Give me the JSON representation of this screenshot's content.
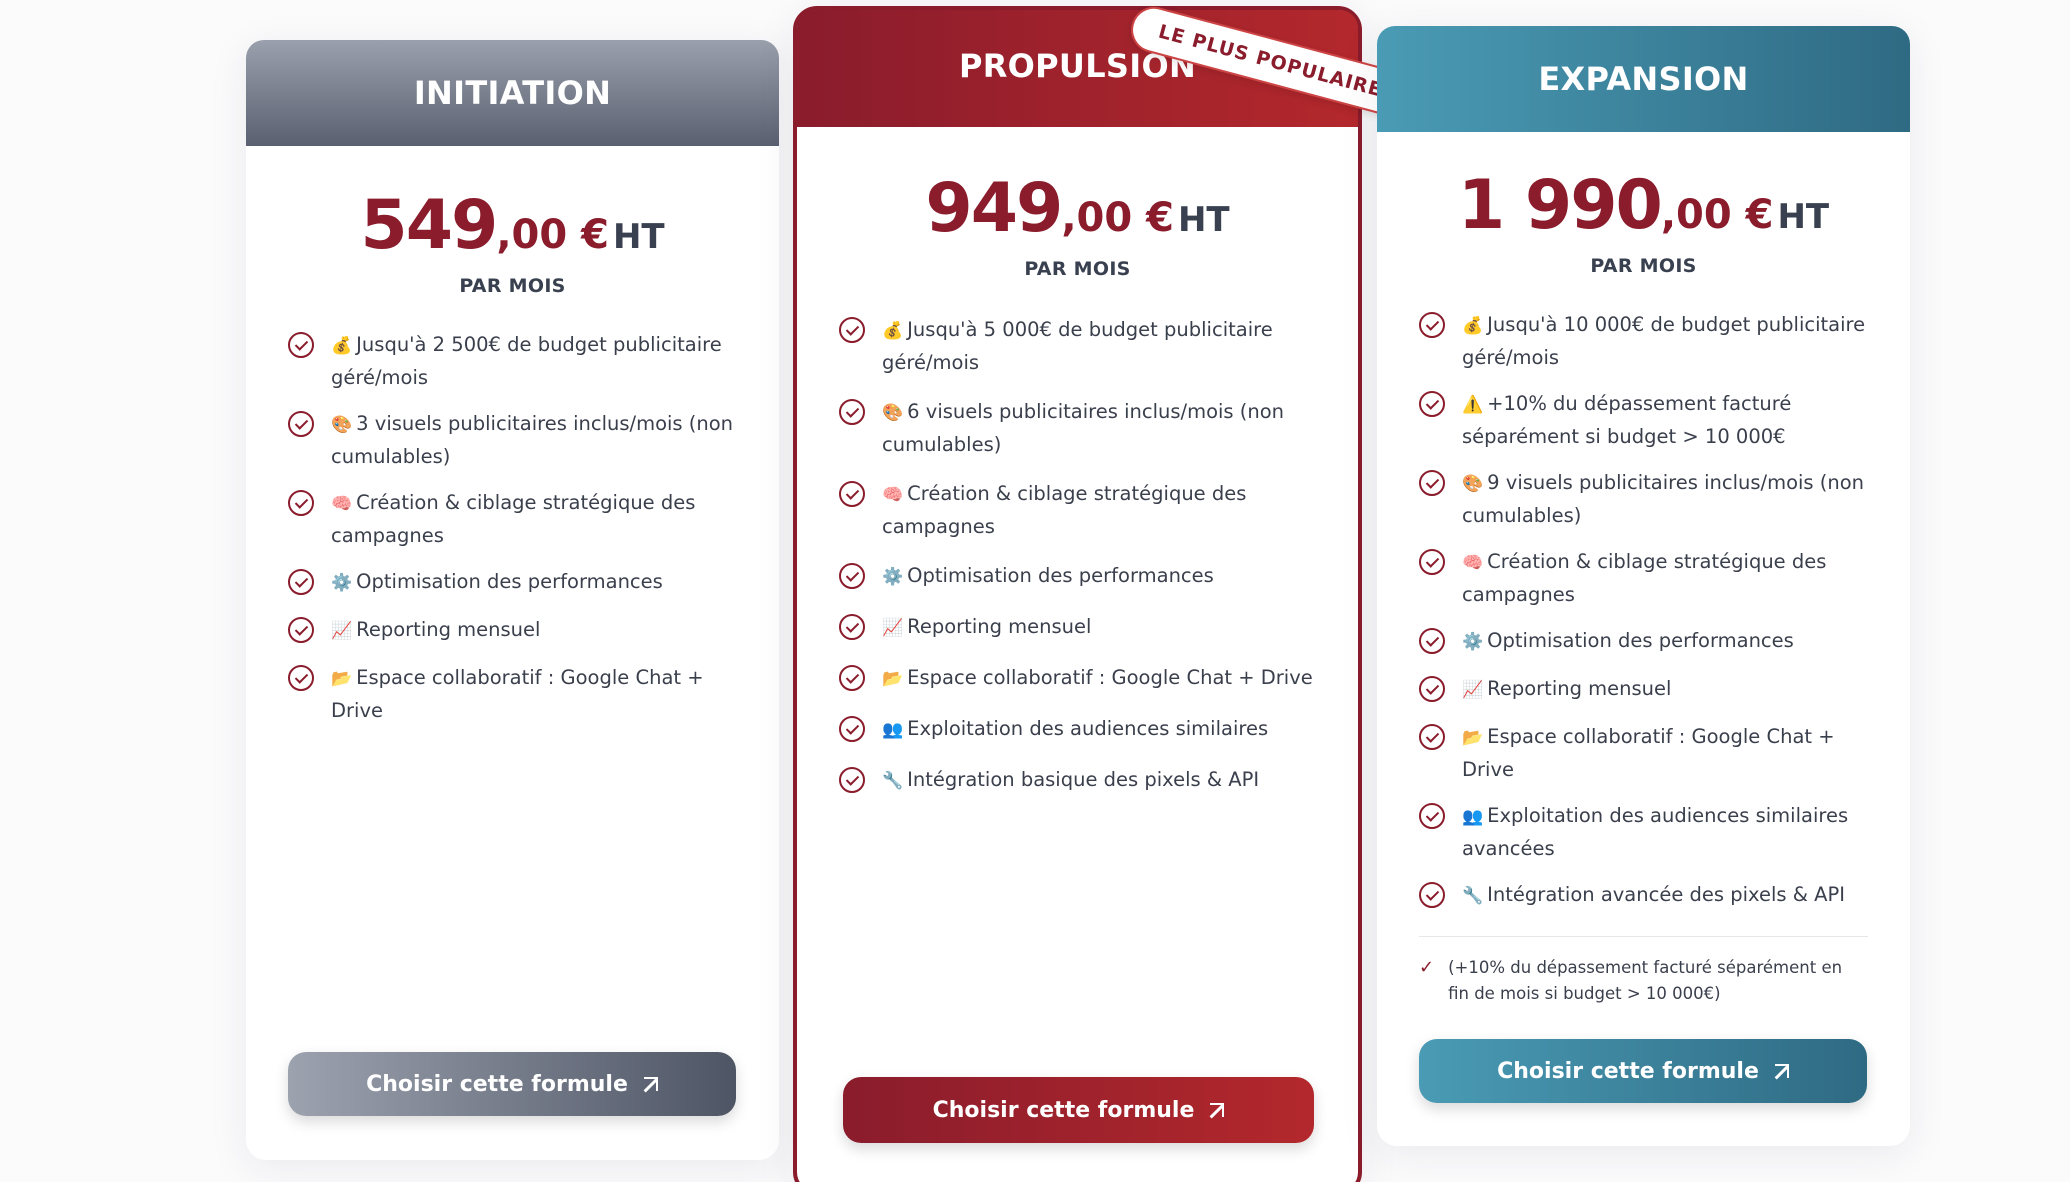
{
  "plans": [
    {
      "title": "INITIATION",
      "price_main": "549",
      "price_cents": ",00 €",
      "price_suffix": "HT",
      "period": "PAR MOIS",
      "features": [
        {
          "icon": "💰",
          "text": "Jusqu'à 2 500€ de budget publicitaire géré/mois"
        },
        {
          "icon": "🎨",
          "text": "3 visuels publicitaires inclus/mois (non cumulables)"
        },
        {
          "icon": "🧠",
          "text": "Création & ciblage stratégique des campagnes"
        },
        {
          "icon": "⚙️",
          "text": "Optimisation des performances"
        },
        {
          "icon": "📈",
          "text": "Reporting mensuel"
        },
        {
          "icon": "📂",
          "text": "Espace collaboratif : Google Chat + Drive"
        }
      ],
      "button": "Choisir cette formule"
    },
    {
      "title": "PROPULSION",
      "badge": "LE PLUS POPULAIRE",
      "price_main": "949",
      "price_cents": ",00 €",
      "price_suffix": "HT",
      "period": "PAR MOIS",
      "features": [
        {
          "icon": "💰",
          "text": "Jusqu'à 5 000€ de budget publicitaire géré/mois"
        },
        {
          "icon": "🎨",
          "text": "6 visuels publicitaires inclus/mois (non cumulables)"
        },
        {
          "icon": "🧠",
          "text": "Création & ciblage stratégique des campagnes"
        },
        {
          "icon": "⚙️",
          "text": "Optimisation des performances"
        },
        {
          "icon": "📈",
          "text": "Reporting mensuel"
        },
        {
          "icon": "📂",
          "text": "Espace collaboratif : Google Chat + Drive"
        },
        {
          "icon": "👥",
          "text": "Exploitation des audiences similaires"
        },
        {
          "icon": "🔧",
          "text": "Intégration basique des pixels & API"
        }
      ],
      "button": "Choisir cette formule"
    },
    {
      "title": "EXPANSION",
      "price_main": "1 990",
      "price_cents": ",00 €",
      "price_suffix": "HT",
      "period": "PAR MOIS",
      "features": [
        {
          "icon": "💰",
          "text": "Jusqu'à 10 000€ de budget publicitaire géré/mois"
        },
        {
          "icon": "⚠️",
          "text": "+10% du dépassement facturé séparément si budget > 10 000€"
        },
        {
          "icon": "🎨",
          "text": "9 visuels publicitaires inclus/mois (non cumulables)"
        },
        {
          "icon": "🧠",
          "text": "Création & ciblage stratégique des campagnes"
        },
        {
          "icon": "⚙️",
          "text": "Optimisation des performances"
        },
        {
          "icon": "📈",
          "text": "Reporting mensuel"
        },
        {
          "icon": "📂",
          "text": "Espace collaboratif : Google Chat + Drive"
        },
        {
          "icon": "👥",
          "text": "Exploitation des audiences similaires avancées"
        },
        {
          "icon": "🔧",
          "text": "Intégration avancée des pixels & API"
        }
      ],
      "note": "(+10% du dépassement facturé séparément en fin de mois si budget > 10 000€)",
      "button": "Choisir cette formule"
    }
  ],
  "colors": {
    "accent": "#8a1c2c",
    "initiation_from": "#9aa0ac",
    "initiation_to": "#4e5565",
    "propulsion_from": "#8a1c2c",
    "propulsion_to": "#b5282a",
    "expansion_from": "#4a9bb5",
    "expansion_to": "#2f6a83"
  }
}
